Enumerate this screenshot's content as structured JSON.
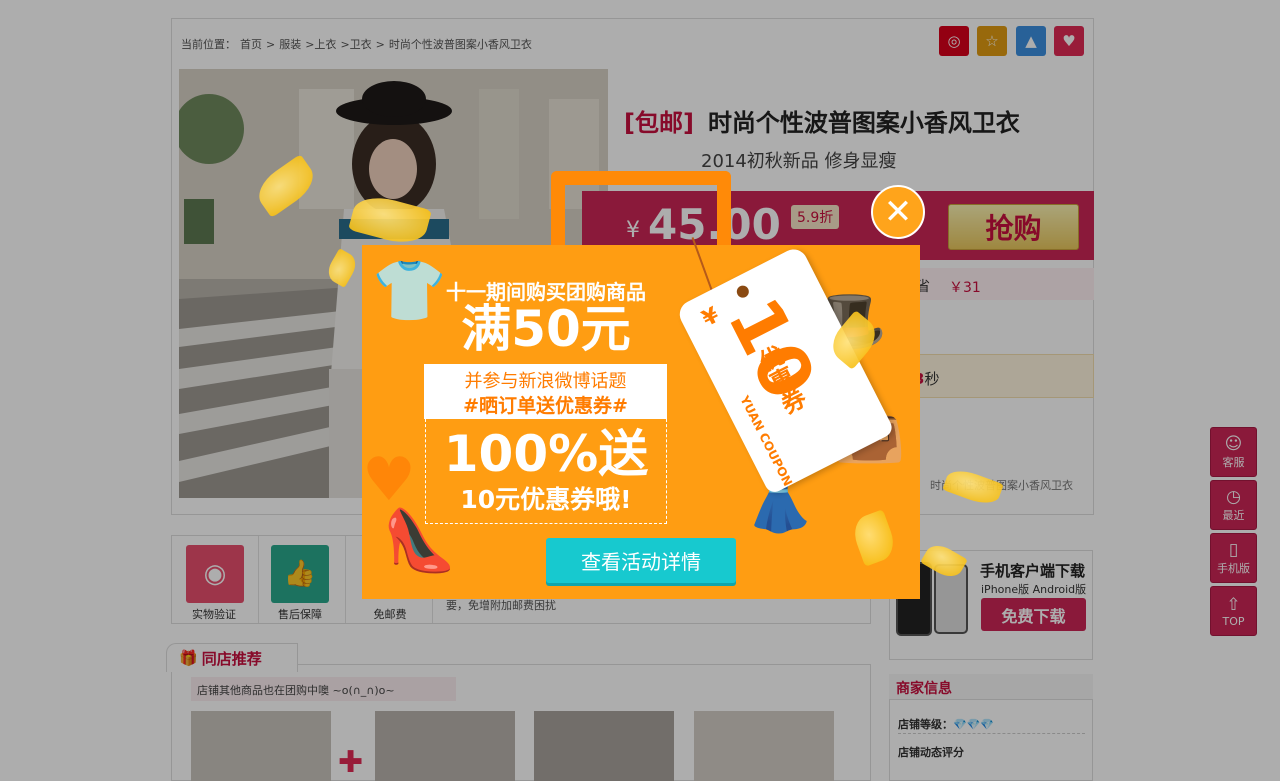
{
  "breadcrumb": {
    "prefix": "当前位置：",
    "items": [
      "首页",
      ">",
      "服装",
      ">上衣",
      ">卫衣",
      ">",
      "时尚个性波普图案小香风卫衣"
    ]
  },
  "share_icons": [
    {
      "name": "weibo-icon",
      "glyph": "◎",
      "color": "#d9001b"
    },
    {
      "name": "star-icon",
      "glyph": "☆",
      "color": "#e19b12"
    },
    {
      "name": "qq-icon",
      "glyph": "▲",
      "color": "#3b8fe0"
    },
    {
      "name": "favorite-icon",
      "glyph": "♥",
      "color": "#e12a55"
    }
  ],
  "product": {
    "tag": "[包邮]",
    "title": "时尚个性波普图案小香风卫衣",
    "subtitle": "2014初秋新品  修身显瘦",
    "price_currency": "¥",
    "price": "45.00",
    "discount": "5.9折",
    "buy_label": "抢购",
    "save_label": "省",
    "save_value": "￥31",
    "time_prefix": "",
    "time_num": "3",
    "time_suffix": "秒",
    "small_name": "时尚个性波普图案小香风卫衣"
  },
  "services": [
    {
      "label": "实物验证",
      "glyph": "◉",
      "color": "#e84f6e"
    },
    {
      "label": "售后保障",
      "glyph": "👍",
      "color": "#2aa88c"
    },
    {
      "label": "免邮费",
      "glyph": "",
      "color": "#ffffff"
    }
  ],
  "service_note": "要，免增附加邮费困扰",
  "app": {
    "title": "手机客户端下载",
    "platforms": "iPhone版   Android版",
    "download_label": "免费下载"
  },
  "recommend": {
    "tab_label": "同店推荐",
    "note": "店铺其他商品也在团购中噢 ~o(∩_∩)o~"
  },
  "merchant": {
    "title": "商家信息",
    "level_label": "店铺等级：",
    "level_value": "💎💎💎",
    "rating_label": "店铺动态评分"
  },
  "sidebar": [
    {
      "label": "客服",
      "glyph": "☺"
    },
    {
      "label": "最近",
      "glyph": "◷"
    },
    {
      "label": "手机版",
      "glyph": "▯"
    },
    {
      "label": "TOP",
      "glyph": "⇧"
    }
  ],
  "popup": {
    "line1": "十一期间购买团购商品",
    "line2": "满50元",
    "white1": "并参与新浪微博话题",
    "white2": "#晒订单送优惠券#",
    "big": "100%送",
    "mid": "10元优惠券哦!",
    "button": "查看活动详情",
    "close": "✕",
    "coupon_yen": "¥",
    "coupon_num": "10",
    "coupon_text": "优惠券",
    "coupon_en": "YUAN COUPON"
  }
}
